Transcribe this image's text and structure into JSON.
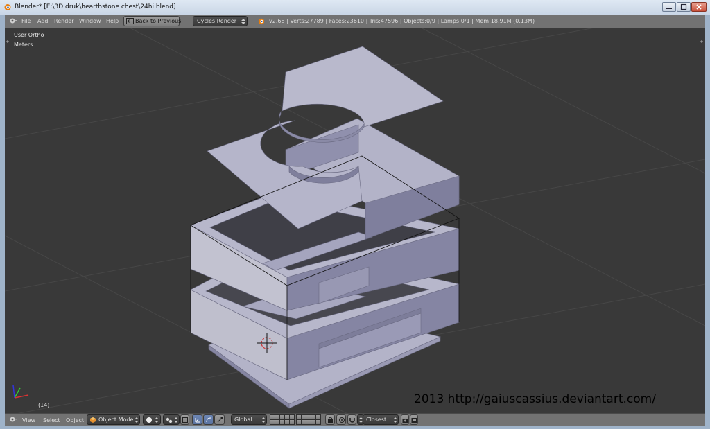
{
  "window": {
    "title": "Blender* [E:\\3D druk\\hearthstone chest\\24hi.blend]"
  },
  "menubar": {
    "items": [
      "File",
      "Add",
      "Render",
      "Window",
      "Help"
    ],
    "back_button": "Back to Previous",
    "render_engine": "Cycles Render",
    "info": "v2.68 | Verts:27789 | Faces:23610 | Tris:47596 | Objects:0/9 | Lamps:0/1 | Mem:18.91M (0.13M)"
  },
  "viewport": {
    "view_name": "User Ortho",
    "units": "Meters",
    "frame": "(14)"
  },
  "footer": {
    "items": [
      "View",
      "Select",
      "Object"
    ],
    "mode": "Object Mode",
    "orientation": "Global",
    "snap_target": "Closest"
  },
  "watermark": "2013 http://gaiuscassius.deviantart.com/",
  "colors": {
    "viewport_bg": "#393939",
    "model_top": "#b9b9cc",
    "model_light": "#a5a5be",
    "model_side": "#8b8ba8",
    "model_dark": "#70708c"
  }
}
